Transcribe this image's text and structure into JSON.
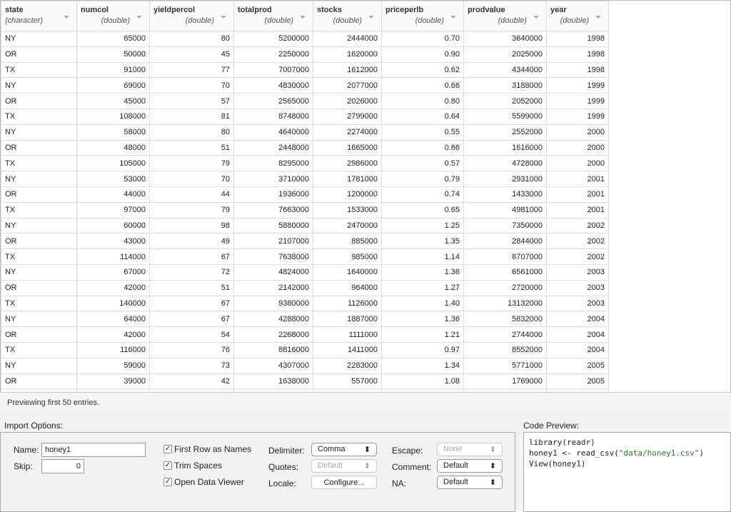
{
  "columns": [
    {
      "name": "state",
      "type": "(character)",
      "num": false
    },
    {
      "name": "numcol",
      "type": "(double)",
      "num": true
    },
    {
      "name": "yieldpercol",
      "type": "(double)",
      "num": true
    },
    {
      "name": "totalprod",
      "type": "(double)",
      "num": true
    },
    {
      "name": "stocks",
      "type": "(double)",
      "num": true
    },
    {
      "name": "priceperlb",
      "type": "(double)",
      "num": true
    },
    {
      "name": "prodvalue",
      "type": "(double)",
      "num": true
    },
    {
      "name": "year",
      "type": "(double)",
      "num": true
    }
  ],
  "rows": [
    [
      "NY",
      "65000",
      "80",
      "5200000",
      "2444000",
      "0.70",
      "3640000",
      "1998"
    ],
    [
      "OR",
      "50000",
      "45",
      "2250000",
      "1620000",
      "0.90",
      "2025000",
      "1998"
    ],
    [
      "TX",
      "91000",
      "77",
      "7007000",
      "1612000",
      "0.62",
      "4344000",
      "1998"
    ],
    [
      "NY",
      "69000",
      "70",
      "4830000",
      "2077000",
      "0.66",
      "3188000",
      "1999"
    ],
    [
      "OR",
      "45000",
      "57",
      "2565000",
      "2026000",
      "0.80",
      "2052000",
      "1999"
    ],
    [
      "TX",
      "108000",
      "81",
      "8748000",
      "2799000",
      "0.64",
      "5599000",
      "1999"
    ],
    [
      "NY",
      "58000",
      "80",
      "4640000",
      "2274000",
      "0.55",
      "2552000",
      "2000"
    ],
    [
      "OR",
      "48000",
      "51",
      "2448000",
      "1665000",
      "0.66",
      "1616000",
      "2000"
    ],
    [
      "TX",
      "105000",
      "79",
      "8295000",
      "2986000",
      "0.57",
      "4728000",
      "2000"
    ],
    [
      "NY",
      "53000",
      "70",
      "3710000",
      "1781000",
      "0.79",
      "2931000",
      "2001"
    ],
    [
      "OR",
      "44000",
      "44",
      "1936000",
      "1200000",
      "0.74",
      "1433000",
      "2001"
    ],
    [
      "TX",
      "97000",
      "79",
      "7663000",
      "1533000",
      "0.65",
      "4981000",
      "2001"
    ],
    [
      "NY",
      "60000",
      "98",
      "5880000",
      "2470000",
      "1.25",
      "7350000",
      "2002"
    ],
    [
      "OR",
      "43000",
      "49",
      "2107000",
      "885000",
      "1.35",
      "2844000",
      "2002"
    ],
    [
      "TX",
      "114000",
      "67",
      "7638000",
      "985000",
      "1.14",
      "8707000",
      "2002"
    ],
    [
      "NY",
      "67000",
      "72",
      "4824000",
      "1640000",
      "1.36",
      "6561000",
      "2003"
    ],
    [
      "OR",
      "42000",
      "51",
      "2142000",
      "964000",
      "1.27",
      "2720000",
      "2003"
    ],
    [
      "TX",
      "140000",
      "67",
      "9380000",
      "1126000",
      "1.40",
      "13132000",
      "2003"
    ],
    [
      "NY",
      "64000",
      "67",
      "4288000",
      "1887000",
      "1.36",
      "5832000",
      "2004"
    ],
    [
      "OR",
      "42000",
      "54",
      "2268000",
      "1111000",
      "1.21",
      "2744000",
      "2004"
    ],
    [
      "TX",
      "116000",
      "76",
      "8816000",
      "1411000",
      "0.97",
      "8552000",
      "2004"
    ],
    [
      "NY",
      "59000",
      "73",
      "4307000",
      "2283000",
      "1.34",
      "5771000",
      "2005"
    ],
    [
      "OR",
      "39000",
      "42",
      "1638000",
      "557000",
      "1.08",
      "1769000",
      "2005"
    ]
  ],
  "status": "Previewing first 50 entries.",
  "import_options": {
    "title": "Import Options:",
    "name_label": "Name:",
    "name_value": "honey1",
    "skip_label": "Skip:",
    "skip_value": "0",
    "first_row": "First Row as Names",
    "trim": "Trim Spaces",
    "open_viewer": "Open Data Viewer",
    "delimiter_label": "Delimiter:",
    "delimiter_value": "Comma",
    "quotes_label": "Quotes:",
    "quotes_value": "Default",
    "locale_label": "Locale:",
    "locale_button": "Configure...",
    "escape_label": "Escape:",
    "escape_value": "None",
    "comment_label": "Comment:",
    "comment_value": "Default",
    "na_label": "NA:",
    "na_value": "Default",
    "check_mark": "✓"
  },
  "code_preview": {
    "title": "Code Preview:",
    "line1_fn": "library",
    "line1_arg": "readr",
    "line2_pre": "honey1 <- read_csv(",
    "line2_str": "\"data/honey1.csv\"",
    "line2_post": ")",
    "line3": "View(honey1)"
  }
}
